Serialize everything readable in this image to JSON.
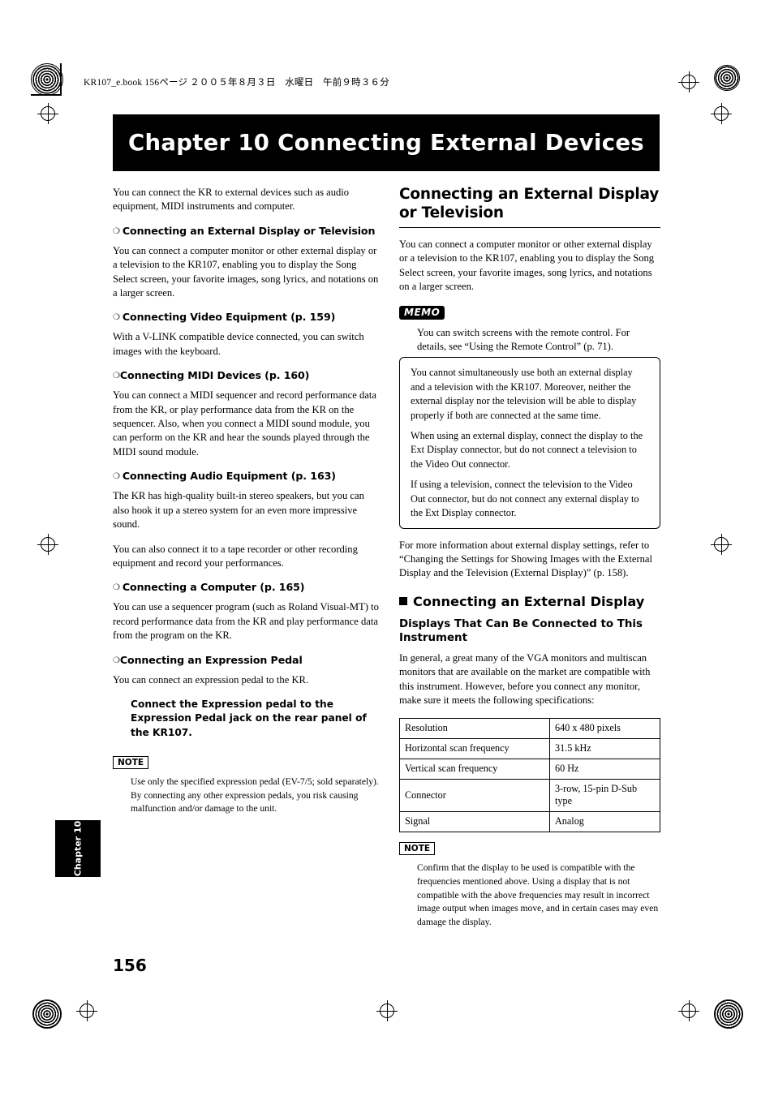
{
  "header": {
    "file_line": "KR107_e.book  156ページ  ２００５年８月３日　水曜日　午前９時３６分"
  },
  "chapter_banner": "Chapter 10 Connecting External Devices",
  "left_column": {
    "intro": "You can connect the KR to external devices such as audio equipment, MIDI instruments and computer.",
    "sections": [
      {
        "heading": "Connecting an External Display or Television",
        "body": "You can connect a computer monitor or other external display or a television to the KR107, enabling you to display the Song Select screen, your favorite images, song lyrics, and notations on a larger screen."
      },
      {
        "heading": "Connecting Video Equipment (p. 159)",
        "body": "With a V-LINK compatible device connected, you can switch images with the keyboard."
      },
      {
        "heading": "Connecting MIDI Devices (p. 160)",
        "body": "You can connect a MIDI sequencer and record performance data from the KR, or play performance data from the KR on the sequencer. Also, when you connect a MIDI sound module, you can perform on the KR and hear the sounds played through the MIDI sound module."
      },
      {
        "heading": "Connecting Audio Equipment (p. 163)",
        "body": "The KR has high-quality built-in stereo speakers, but you can also hook it up a stereo system for an even more impressive sound.",
        "body2": "You can also connect it to a tape recorder or other recording equipment and record your performances."
      },
      {
        "heading": "Connecting a Computer (p. 165)",
        "body": "You can use a sequencer program (such as Roland Visual-MT) to record performance data from the KR and play performance data from the program on the KR."
      },
      {
        "heading": "Connecting an Expression Pedal",
        "body": "You can connect an expression pedal to the KR."
      }
    ],
    "expression_bold": "Connect the Expression pedal to the Expression Pedal jack on the rear panel of the KR107.",
    "note_badge": "NOTE",
    "note_text": "Use only the specified expression pedal (EV-7/5; sold separately). By connecting any other expression pedals, you risk causing malfunction and/or damage to the unit."
  },
  "right_column": {
    "title": "Connecting an External Display or Television",
    "intro": "You can connect a computer monitor or other external display or a television to the KR107, enabling you to display the Song Select screen, your favorite images, song lyrics, and notations on a larger screen.",
    "memo_badge": "MEMO",
    "memo_text": "You can switch screens with the remote control. For details, see “Using the Remote Control” (p. 71).",
    "caution": [
      "You cannot simultaneously use both an external display and a television with the KR107. Moreover, neither the external display nor the television will be able to display properly if both are connected at the same time.",
      "When using an external display, connect the display to the Ext Display connector, but do not connect a television to the Video Out connector.",
      "If using a television, connect the television to the Video Out connector, but do not connect any external display to the Ext Display connector."
    ],
    "after_caution": "For more information about external display settings, refer to “Changing the Settings for Showing Images with the External Display and the Television (External Display)” (p. 158).",
    "sub_heading": "Connecting an External Display",
    "sub_sub_heading": "Displays That Can Be Connected to This Instrument",
    "sub_body": "In general, a great many of the VGA monitors and multiscan monitors that are available on the market are compatible with this instrument. However, before you connect any monitor, make sure it meets the following specifications:",
    "spec_table": {
      "rows": [
        {
          "key": "Resolution",
          "value": "640 x 480 pixels"
        },
        {
          "key": "Horizontal scan frequency",
          "value": "31.5 kHz"
        },
        {
          "key": "Vertical scan frequency",
          "value": "60 Hz"
        },
        {
          "key": "Connector",
          "value": "3-row, 15-pin D-Sub type"
        },
        {
          "key": "Signal",
          "value": "Analog"
        }
      ]
    },
    "note_badge": "NOTE",
    "note_text": "Confirm that the display to be used is compatible with the frequencies mentioned above. Using a display that is not compatible with the above frequencies may result in incorrect image output when images move, and in certain cases may even damage the display."
  },
  "side_tab": "Chapter 10",
  "page_number": "156"
}
